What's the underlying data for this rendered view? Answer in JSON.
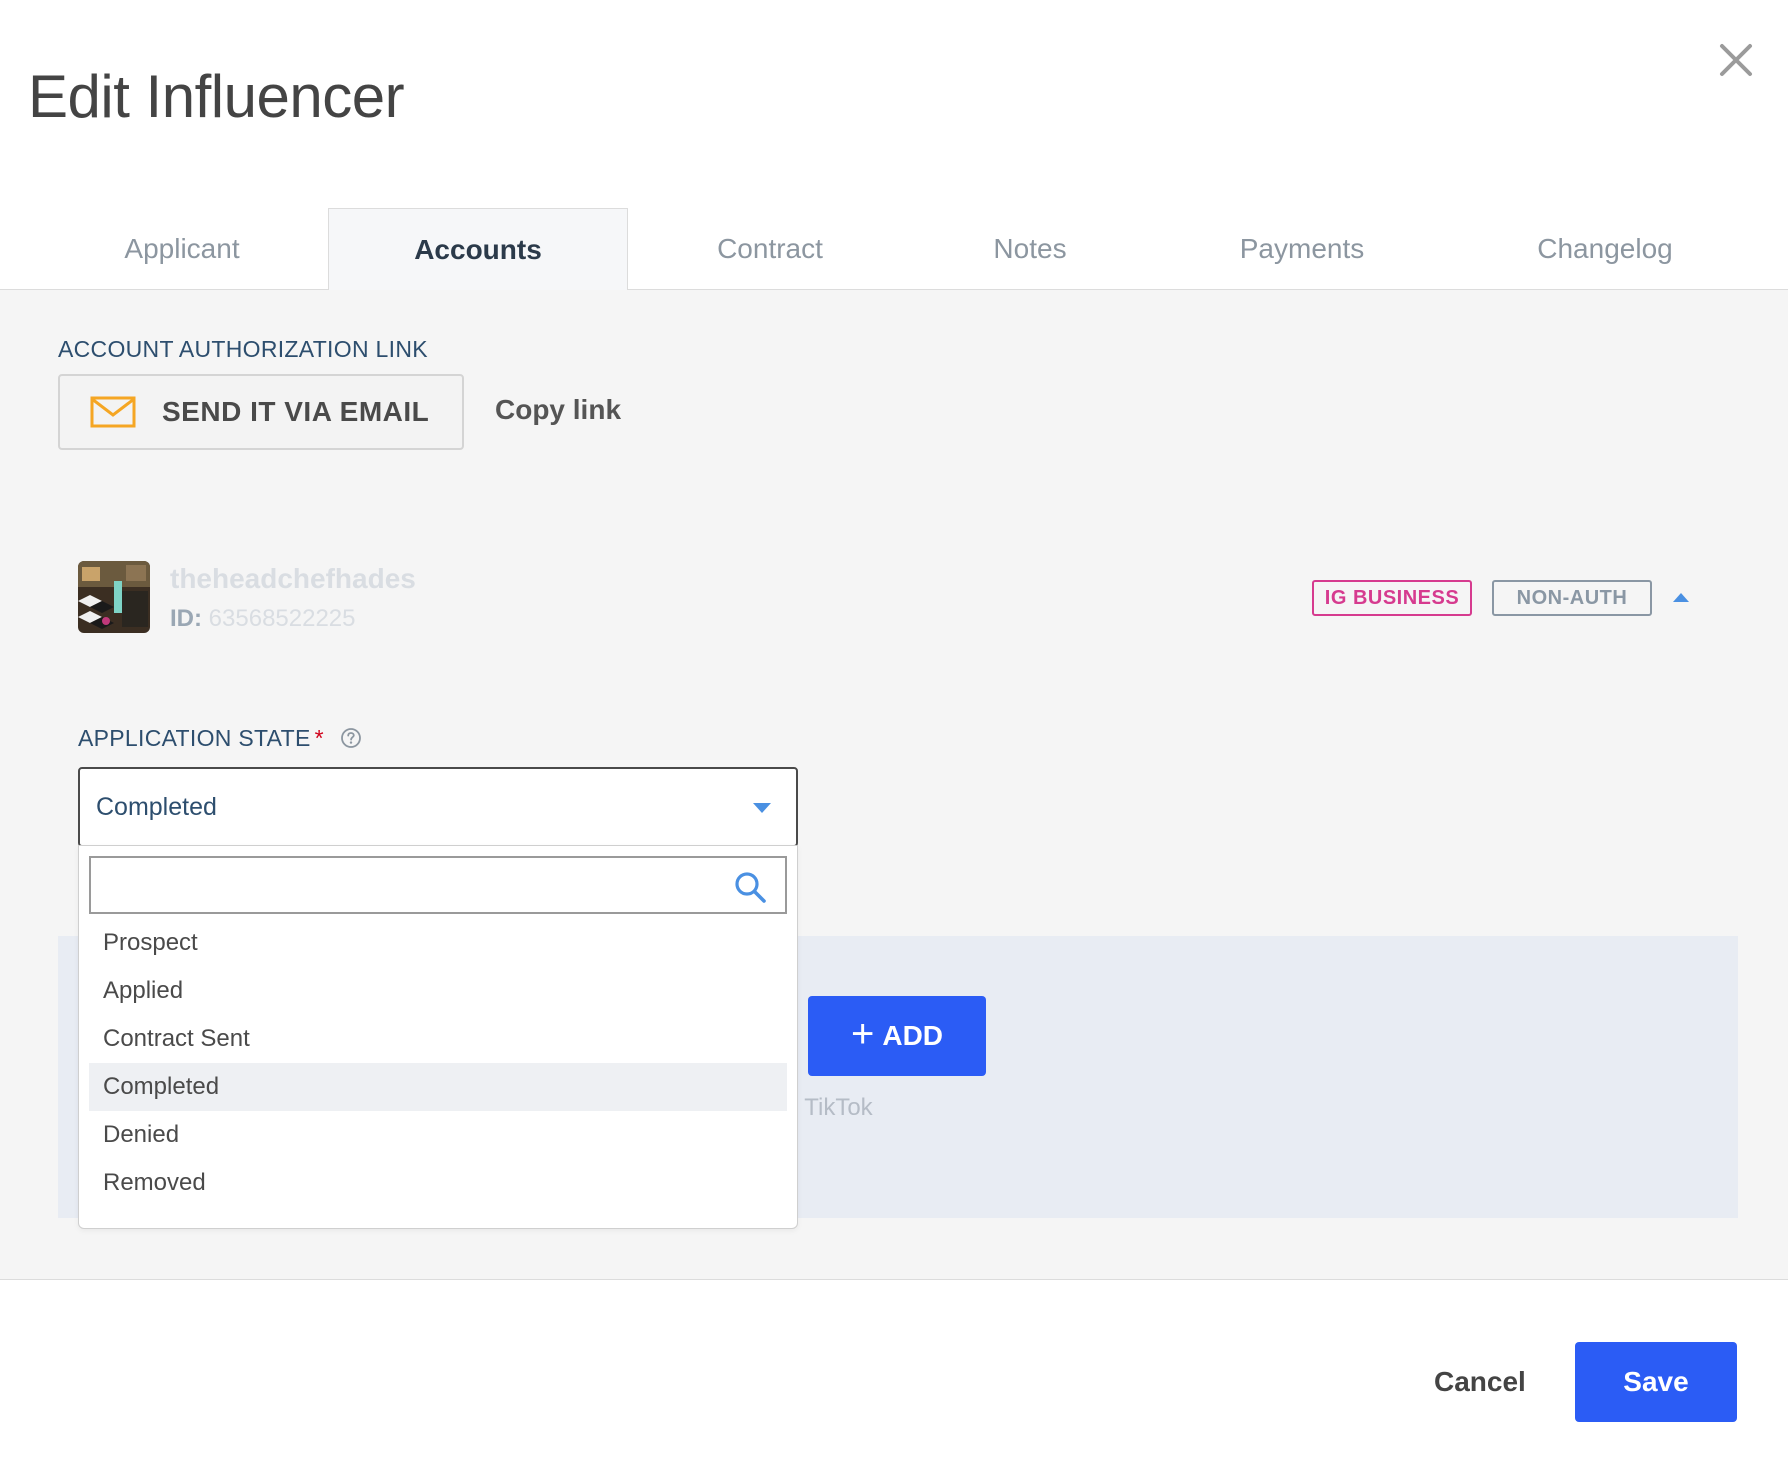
{
  "dialog": {
    "title": "Edit Influencer",
    "close_icon": "close-icon"
  },
  "tabs": [
    {
      "label": "Applicant",
      "active": false
    },
    {
      "label": "Accounts",
      "active": true
    },
    {
      "label": "Contract",
      "active": false
    },
    {
      "label": "Notes",
      "active": false
    },
    {
      "label": "Payments",
      "active": false
    },
    {
      "label": "Changelog",
      "active": false
    }
  ],
  "authorization": {
    "label": "ACCOUNT AUTHORIZATION LINK",
    "email_button": "SEND IT VIA EMAIL",
    "email_icon": "envelope-icon",
    "copy_link": "Copy link"
  },
  "account": {
    "username": "theheadchefhades",
    "id_label": "ID:",
    "id_value": "63568522225",
    "badges": [
      "IG BUSINESS",
      "NON-AUTH"
    ],
    "badge_colors": {
      "ig_business": "#d63b8f",
      "non_auth": "#8a97a4"
    }
  },
  "application_state": {
    "label": "APPLICATION STATE",
    "required_mark": "*",
    "selected": "Completed",
    "search_placeholder": "",
    "options": [
      "Prospect",
      "Applied",
      "Contract Sent",
      "Completed",
      "Denied",
      "Removed"
    ]
  },
  "add_panel": {
    "add_button": "ADD",
    "hint_fragment": "r TikTok"
  },
  "footer": {
    "cancel": "Cancel",
    "save": "Save"
  },
  "colors": {
    "primary": "#2b5cf5",
    "label_blue": "#2d4e6e",
    "accent_blue": "#4a90e2"
  }
}
